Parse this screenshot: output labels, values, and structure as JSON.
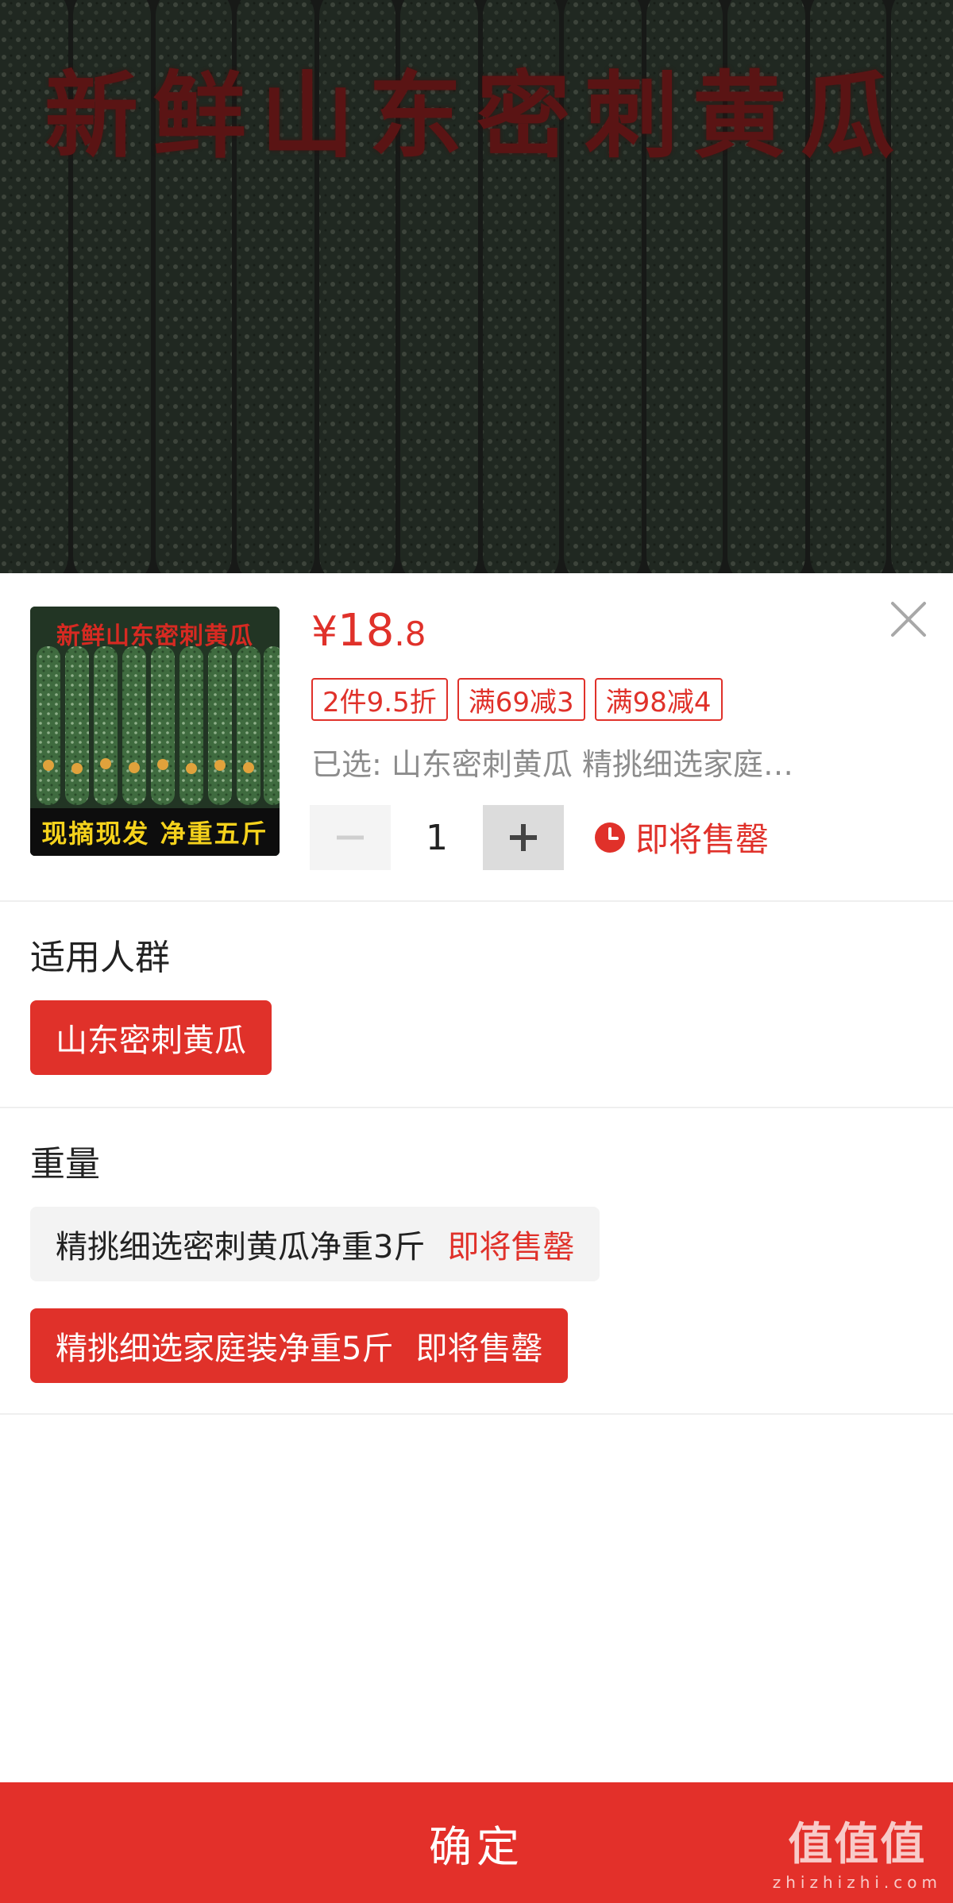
{
  "banner": {
    "title": "新鲜山东密刺黄瓜"
  },
  "product": {
    "thumb_title": "新鲜山东密刺黄瓜",
    "thumb_caption": "现摘现发 净重五斤",
    "price_symbol": "¥",
    "price_int": "18",
    "price_dec": ".8",
    "tags": [
      "2件9.5折",
      "满69减3",
      "满98减4"
    ],
    "selected_text": "已选: 山东密刺黄瓜 精挑细选家庭…",
    "quantity": "1",
    "stock_status": "即将售罄"
  },
  "sections": {
    "group_title": "适用人群",
    "group_option": "山东密刺黄瓜",
    "weight_title": "重量",
    "weight_options": [
      {
        "label": "精挑细选密刺黄瓜净重3斤",
        "flag": "即将售罄"
      },
      {
        "label": "精挑细选家庭装净重5斤",
        "flag": "即将售罄"
      }
    ]
  },
  "footer": {
    "confirm_label": "确定",
    "watermark_big": "值值值",
    "watermark_small": "zhizhizhi.com"
  },
  "colors": {
    "accent": "#e0312a",
    "confirm": "#e3302a"
  }
}
